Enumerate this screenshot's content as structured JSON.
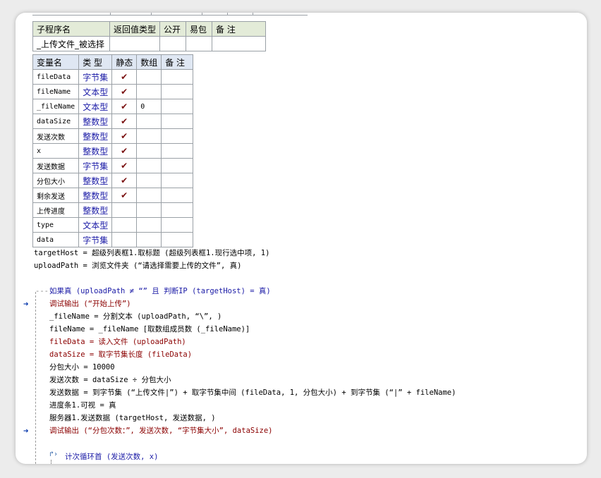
{
  "subroutine_table": {
    "headers": [
      "子程序名",
      "返回值类型",
      "公开",
      "易包",
      "备 注"
    ],
    "row": [
      "_上传文件_被选择",
      "",
      "",
      "",
      ""
    ]
  },
  "variable_table": {
    "headers": [
      "变量名",
      "类 型",
      "静态",
      "数组",
      "备 注"
    ],
    "rows": [
      {
        "name": "fileData",
        "type": "字节集",
        "static": "✔",
        "array": "",
        "note": ""
      },
      {
        "name": "fileName",
        "type": "文本型",
        "static": "✔",
        "array": "",
        "note": ""
      },
      {
        "name": "_fileName",
        "type": "文本型",
        "static": "✔",
        "array": "0",
        "note": ""
      },
      {
        "name": "dataSize",
        "type": "整数型",
        "static": "✔",
        "array": "",
        "note": ""
      },
      {
        "name": "发送次数",
        "type": "整数型",
        "static": "✔",
        "array": "",
        "note": ""
      },
      {
        "name": "x",
        "type": "整数型",
        "static": "✔",
        "array": "",
        "note": ""
      },
      {
        "name": "发送数据",
        "type": "字节集",
        "static": "✔",
        "array": "",
        "note": ""
      },
      {
        "name": "分包大小",
        "type": "整数型",
        "static": "✔",
        "array": "",
        "note": ""
      },
      {
        "name": "剩余发送",
        "type": "整数型",
        "static": "✔",
        "array": "",
        "note": ""
      },
      {
        "name": "上传进度",
        "type": "整数型",
        "static": "",
        "array": "",
        "note": ""
      },
      {
        "name": "type",
        "type": "文本型",
        "static": "",
        "array": "",
        "note": ""
      },
      {
        "name": "data",
        "type": "字节集",
        "static": "",
        "array": "",
        "note": ""
      }
    ]
  },
  "code": {
    "line1": "targetHost = 超级列表框1.取标题 (超级列表框1.现行选中项, 1)",
    "line2": "uploadPath = 浏览文件夹 (“请选择需要上传的文件”, 真)",
    "if_line": "如果真 (uploadPath ≠ “” 且 判断IP (targetHost) = 真)",
    "body": [
      "调试输出 (“开始上传”)",
      "_fileName = 分割文本 (uploadPath, “\\”, )",
      "fileName = _fileName [取数组成员数 (_fileName)]",
      "fileData = 读入文件 (uploadPath)",
      "dataSize = 取字节集长度 (fileData)",
      "分包大小 = 10000",
      "发送次数 = dataSize ÷ 分包大小",
      "发送数据 = 到字节集 (“上传文件|”) + 取字节集中间 (fileData, 1, 分包大小) + 到字节集 (“|” + fileName)",
      "进度条1.可视 = 真",
      "服务器1.发送数据 (targetHost, 发送数据, )",
      "调试输出 (“分包次数：”, 发送次数, “字节集大小”, dataSize)"
    ],
    "loop_line": "计次循环首 (发送次数, x)",
    "markers": [
      "➔",
      "➔"
    ]
  }
}
